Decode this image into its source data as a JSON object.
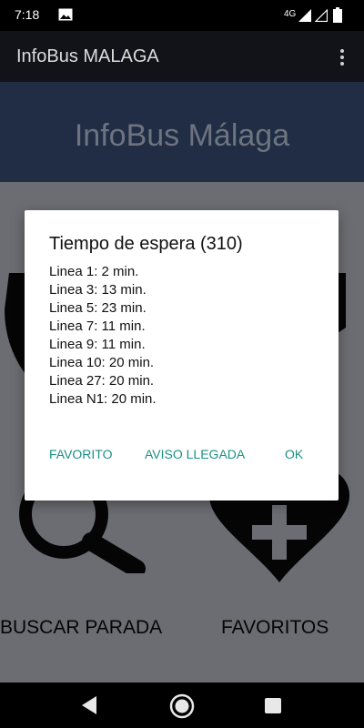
{
  "status_bar": {
    "time": "7:18",
    "network": "4G",
    "icons": [
      "image-notification-icon",
      "signal-icon",
      "signal-empty-icon",
      "battery-icon"
    ]
  },
  "app_bar": {
    "title": "InfoBus MALAGA",
    "overflow_icon": "more-vert-icon"
  },
  "banner": {
    "title": "InfoBus Málaga"
  },
  "tiles": [
    {
      "label": "BUSCAR PARADA",
      "icon": "search-icon"
    },
    {
      "label": "FAVORITOS",
      "icon": "heart-plus-icon"
    }
  ],
  "dialog": {
    "title": "Tiempo de espera (310)",
    "lines": [
      "Linea 1: 2 min.",
      "Linea 3: 13 min.",
      "Linea 5: 23 min.",
      "Linea 7: 11 min.",
      "Linea 9: 11 min.",
      "Linea 10: 20 min.",
      "Linea 27: 20 min.",
      "Linea N1: 20 min."
    ],
    "buttons": {
      "favorito": "FAVORITO",
      "aviso": "AVISO LLEGADA",
      "ok": "OK"
    }
  },
  "nav_bar": {
    "icons": [
      "back-icon",
      "home-icon",
      "recents-icon"
    ]
  },
  "colors": {
    "status_bar": "#000000",
    "app_bar": "#111318",
    "banner": "#202d45",
    "content_scrim": "#6b6d72",
    "accent": "#1b8f86",
    "dialog_bg": "#ffffff"
  }
}
